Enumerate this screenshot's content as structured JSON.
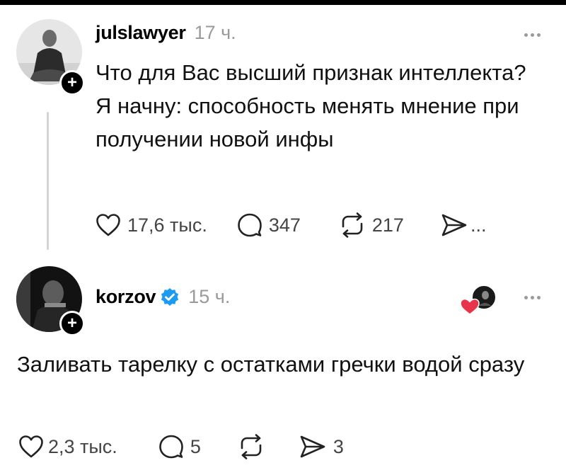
{
  "posts": [
    {
      "username": "julslawyer",
      "time": "17 ч.",
      "follow_symbol": "+",
      "text": [
        "Что для Вас высший признак интеллекта?",
        "Я начну: способность менять мнение при получении новой инфы"
      ],
      "likes": "17,6 тыс.",
      "replies": "347",
      "reposts": "217",
      "shares": "...",
      "icons": [
        "heart-icon",
        "comment-icon",
        "repost-icon",
        "send-icon",
        "more-icon"
      ]
    },
    {
      "username": "korzov",
      "verified": true,
      "time": "15 ч.",
      "follow_symbol": "+",
      "text": [
        "Заливать тарелку с остатками гречки водой сразу"
      ],
      "likes": "2,3 тыс.",
      "replies": "5",
      "reposts": "",
      "shares": "3",
      "icons": [
        "heart-icon",
        "comment-icon",
        "repost-icon",
        "send-icon",
        "more-icon",
        "verified-icon"
      ]
    }
  ],
  "colors": {
    "text": "#111111",
    "muted": "#9a9a9a",
    "verified": "#1d9bf0",
    "like_heart": "#e8334a",
    "thread_line": "#d5d5d5"
  }
}
